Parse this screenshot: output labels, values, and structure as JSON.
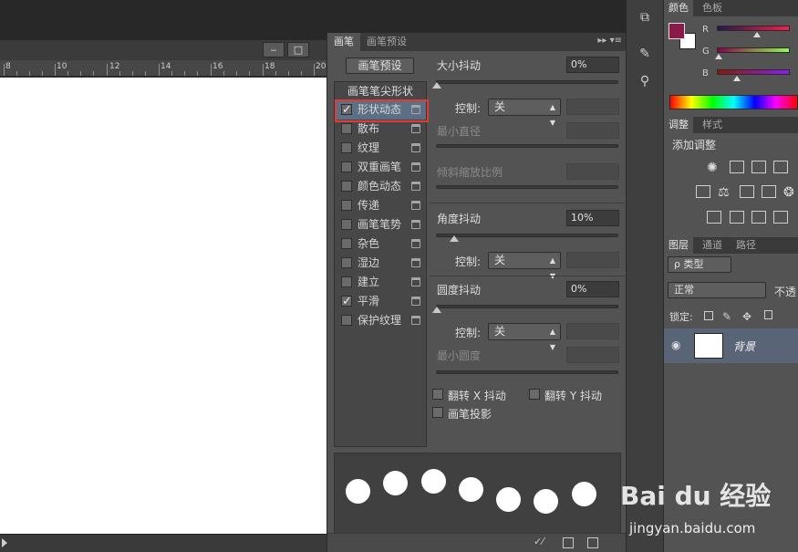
{
  "document": {
    "ruler_ticks": [
      "8",
      "10",
      "12",
      "14",
      "16",
      "18",
      "20"
    ],
    "window_buttons": [
      "‒",
      "□"
    ]
  },
  "brush_panel": {
    "tabs": [
      "画笔",
      "画笔预设"
    ],
    "active_tab": "画笔",
    "preset_button": "画笔预设",
    "list_header": "画笔笔尖形状",
    "options": [
      {
        "label": "形状动态",
        "checked": true,
        "selected": true
      },
      {
        "label": "散布",
        "checked": false
      },
      {
        "label": "纹理",
        "checked": false
      },
      {
        "label": "双重画笔",
        "checked": false
      },
      {
        "label": "颜色动态",
        "checked": false
      },
      {
        "label": "传递",
        "checked": false
      },
      {
        "label": "画笔笔势",
        "checked": false
      },
      {
        "label": "杂色",
        "checked": false
      },
      {
        "label": "湿边",
        "checked": false
      },
      {
        "label": "建立",
        "checked": false
      },
      {
        "label": "平滑",
        "checked": true
      },
      {
        "label": "保护纹理",
        "checked": false
      }
    ],
    "size_jitter": {
      "label": "大小抖动",
      "value": "0%"
    },
    "control_label": "控制:",
    "control_value": "关",
    "min_diameter": "最小直径",
    "tilt_scale": "倾斜缩放比例",
    "angle_jitter": {
      "label": "角度抖动",
      "value": "10%"
    },
    "roundness_jitter": {
      "label": "圆度抖动",
      "value": "0%"
    },
    "min_roundness": "最小圆度",
    "flip_x": "翻转 X 抖动",
    "flip_y": "翻转 Y 抖动",
    "brush_projection": "画笔投影"
  },
  "right_panels": {
    "color_tabs": [
      "颜色",
      "色板"
    ],
    "channels": [
      {
        "label": "R",
        "level": 0.55
      },
      {
        "label": "G",
        "level": 0.02
      },
      {
        "label": "B",
        "level": 0.28
      }
    ],
    "foreground_color": "#8b1a4a",
    "background_color": "#ffffff",
    "adjust_tabs": [
      "调整",
      "样式"
    ],
    "add_adjustment": "添加调整",
    "layer_tabs": [
      "图层",
      "通道",
      "路径"
    ],
    "filter_kind": "ρ 类型",
    "blend_mode": "正常",
    "opacity_label": "不透",
    "lock_label": "锁定:",
    "layer_name": "背景"
  },
  "watermark": {
    "logo": "Bai du 经验",
    "url": "jingyan.baidu.com"
  }
}
